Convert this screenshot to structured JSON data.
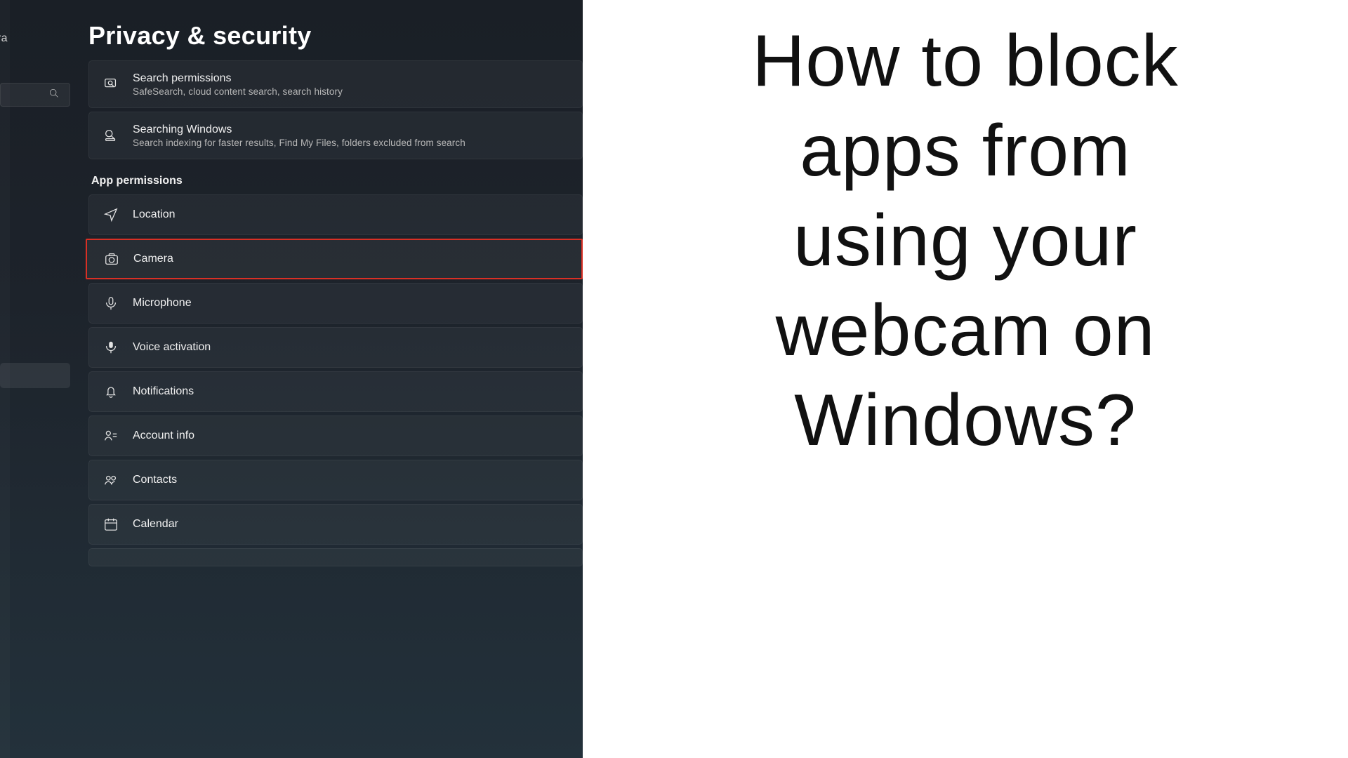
{
  "sidebar": {
    "clipped_label": "ra"
  },
  "page": {
    "title": "Privacy & security"
  },
  "top_cards": [
    {
      "title": "Search permissions",
      "sub": "SafeSearch, cloud content search, search history"
    },
    {
      "title": "Searching Windows",
      "sub": "Search indexing for faster results, Find My Files, folders excluded from search"
    }
  ],
  "section": {
    "heading": "App permissions"
  },
  "permissions": [
    {
      "label": "Location"
    },
    {
      "label": "Camera"
    },
    {
      "label": "Microphone"
    },
    {
      "label": "Voice activation"
    },
    {
      "label": "Notifications"
    },
    {
      "label": "Account info"
    },
    {
      "label": "Contacts"
    },
    {
      "label": "Calendar"
    }
  ],
  "highlight_index": 1,
  "headline": "How to block apps from using your webcam on Windows?"
}
